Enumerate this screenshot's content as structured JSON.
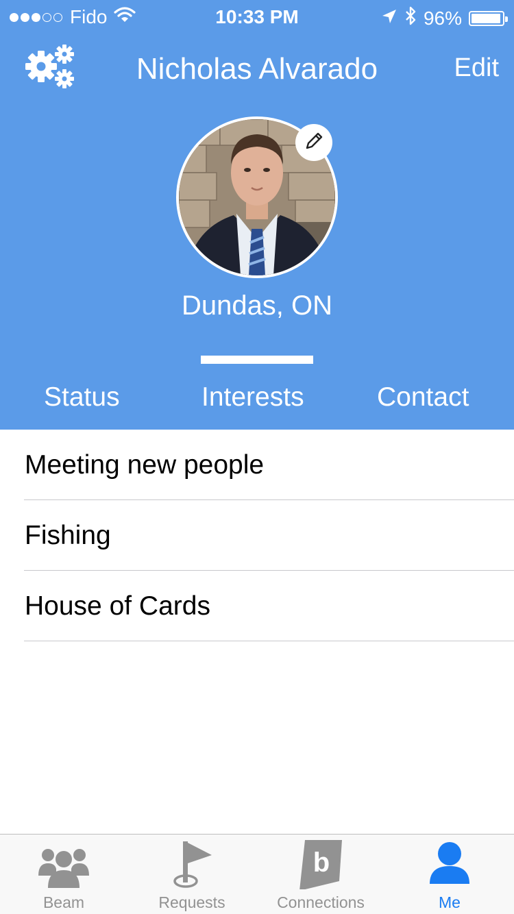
{
  "status_bar": {
    "carrier": "Fido",
    "time": "10:33 PM",
    "battery": "96%",
    "battery_level": 0.96,
    "signal_bars_filled": 3,
    "signal_bars_total": 5
  },
  "nav": {
    "title": "Nicholas Alvarado",
    "edit_label": "Edit",
    "settings_icon": "gears-icon"
  },
  "profile": {
    "location": "Dundas, ON",
    "avatar_edit_icon": "pencil-icon"
  },
  "tabs": [
    {
      "label": "Status",
      "active": false
    },
    {
      "label": "Interests",
      "active": true
    },
    {
      "label": "Contact",
      "active": false
    }
  ],
  "interests": [
    "Meeting new people",
    "Fishing",
    "House of Cards"
  ],
  "tab_bar": [
    {
      "label": "Beam",
      "icon": "group-icon",
      "active": false
    },
    {
      "label": "Requests",
      "icon": "flag-icon",
      "active": false
    },
    {
      "label": "Connections",
      "icon": "b-logo-icon",
      "active": false
    },
    {
      "label": "Me",
      "icon": "person-icon",
      "active": true
    }
  ],
  "colors": {
    "header_bg": "#5b9be8",
    "active_tab": "#1a7cf2",
    "inactive_tab": "#929292"
  }
}
